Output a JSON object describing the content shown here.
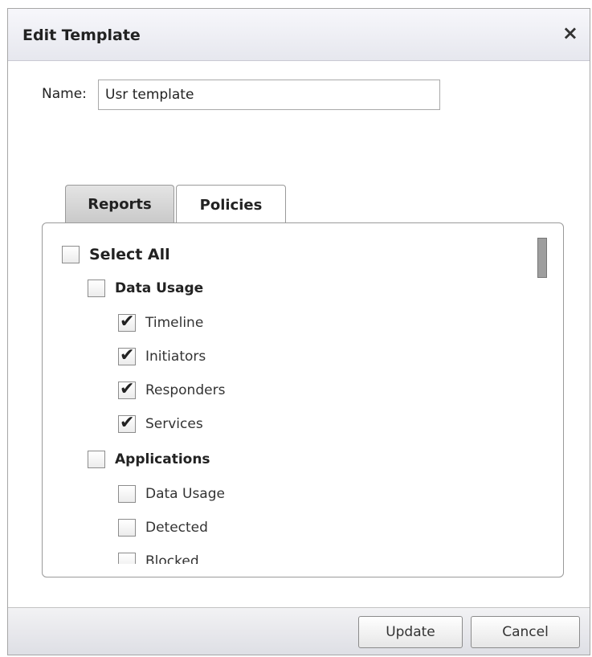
{
  "dialog": {
    "title": "Edit Template",
    "close_glyph": "×"
  },
  "name_field": {
    "label": "Name:",
    "value": "Usr template"
  },
  "tabs": [
    {
      "label": "Reports",
      "active": true
    },
    {
      "label": "Policies",
      "active": false
    }
  ],
  "tree": {
    "select_all": {
      "label": "Select All",
      "checked": false
    },
    "groups": [
      {
        "label": "Data Usage",
        "checked": false,
        "items": [
          {
            "label": "Timeline",
            "checked": true
          },
          {
            "label": "Initiators",
            "checked": true
          },
          {
            "label": "Responders",
            "checked": true
          },
          {
            "label": "Services",
            "checked": true
          }
        ]
      },
      {
        "label": "Applications",
        "checked": false,
        "items": [
          {
            "label": "Data Usage",
            "checked": false
          },
          {
            "label": "Detected",
            "checked": false
          },
          {
            "label": "Blocked",
            "checked": false
          }
        ]
      }
    ]
  },
  "buttons": {
    "update": "Update",
    "cancel": "Cancel"
  }
}
